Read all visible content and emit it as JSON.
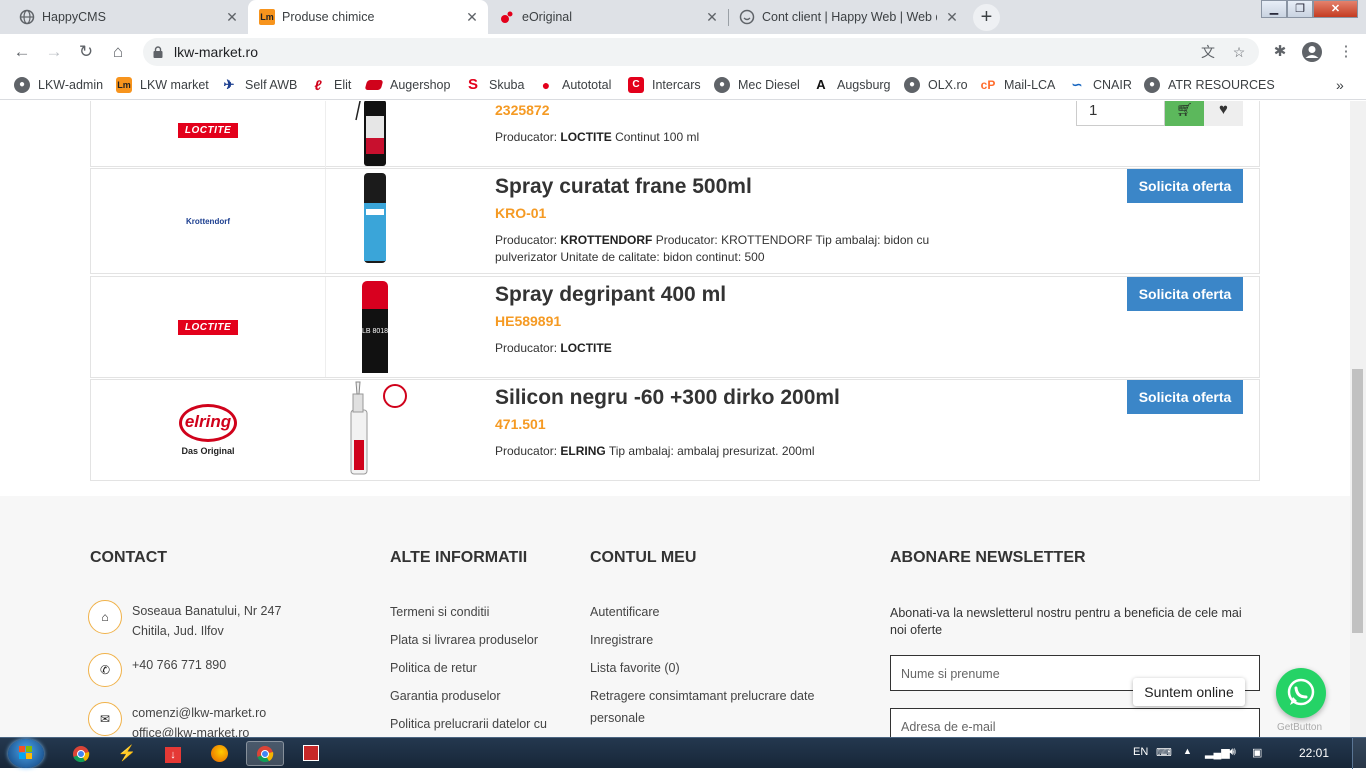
{
  "browser": {
    "tabs": [
      {
        "title": "HappyCMS",
        "active": false,
        "icon": "globe-icon"
      },
      {
        "title": "Produse chimice",
        "active": true,
        "icon": "lm-icon"
      },
      {
        "title": "eOriginal",
        "active": false,
        "icon": "eoriginal-icon"
      },
      {
        "title": "Cont client | Happy Web | Web d",
        "active": false,
        "icon": "happyweb-icon"
      }
    ],
    "url": "lkw-market.ro",
    "bookmarks": [
      {
        "label": "LKW-admin",
        "icon": "globe-icon"
      },
      {
        "label": "LKW market",
        "icon": "lm-icon"
      },
      {
        "label": "Self AWB",
        "icon": "awb-icon"
      },
      {
        "label": "Elit",
        "icon": "elit-icon"
      },
      {
        "label": "Augershop",
        "icon": "augershop-icon"
      },
      {
        "label": "Skuba",
        "icon": "skuba-icon"
      },
      {
        "label": "Autototal",
        "icon": "autototal-icon"
      },
      {
        "label": "Intercars",
        "icon": "intercars-icon"
      },
      {
        "label": "Mec Diesel",
        "icon": "globe-icon"
      },
      {
        "label": "Augsburg",
        "icon": "augsburg-icon"
      },
      {
        "label": "OLX.ro",
        "icon": "globe-icon"
      },
      {
        "label": "Mail-LCA",
        "icon": "cpanel-icon"
      },
      {
        "label": "CNAIR",
        "icon": "cnair-icon"
      },
      {
        "label": "ATR RESOURCES",
        "icon": "globe-icon"
      }
    ]
  },
  "products": [
    {
      "brand": "LOCTITE",
      "name": "",
      "code": "2325872",
      "producer_label": "Producator:",
      "producer": "LOCTITE",
      "details": "Continut 100 ml",
      "qty": "1"
    },
    {
      "brand": "Krottendorf",
      "name": "Spray curatat frane 500ml",
      "code": "KRO-01",
      "producer_label": "Producator:",
      "producer": "KROTTENDORF",
      "details": "Producator: KROTTENDORF Tip ambalaj: bidon cu pulverizator Unitate de calitate: bidon continut: 500",
      "action": "Solicita oferta"
    },
    {
      "brand": "LOCTITE",
      "name": "Spray degripant 400 ml",
      "code": "HE589891",
      "producer_label": "Producator:",
      "producer": "LOCTITE",
      "details": "",
      "action": "Solicita oferta"
    },
    {
      "brand": "elring",
      "brand_sub": "Das Original",
      "name": "Silicon negru -60 +300 dirko 200ml",
      "code": "471.501",
      "producer_label": "Producator:",
      "producer": "ELRING",
      "details": "Tip ambalaj: ambalaj presurizat. 200ml",
      "action": "Solicita oferta"
    }
  ],
  "footer": {
    "contact": {
      "heading": "CONTACT",
      "address_line1": "Soseaua Banatului, Nr 247",
      "address_line2": "Chitila, Jud. Ilfov",
      "phone": "+40 766 771 890",
      "email1": "comenzi@lkw-market.ro",
      "email2": "office@lkw-market.ro"
    },
    "alte": {
      "heading": "ALTE INFORMATII",
      "links": [
        "Termeni si conditii",
        "Plata si livrarea produselor",
        "Politica de retur",
        "Garantia produselor",
        "Politica prelucrarii datelor cu"
      ]
    },
    "cont": {
      "heading": "CONTUL MEU",
      "links": [
        "Autentificare",
        "Inregistrare",
        "Lista favorite (0)",
        "Retragere consimtamant prelucrare date",
        "personale"
      ]
    },
    "newsletter": {
      "heading": "ABONARE NEWSLETTER",
      "text": "Abonati-va la newsletterul nostru pentru a beneficia de cele mai noi oferte",
      "name_placeholder": "Nume si prenume",
      "email_placeholder": "Adresa de e-mail"
    }
  },
  "whatsapp": {
    "label": "Suntem online",
    "credit": "GetButton"
  },
  "taskbar": {
    "lang": "EN",
    "time": "22:01"
  },
  "colors": {
    "accent_orange": "#f59a23",
    "offer_blue": "#3b86c8",
    "cart_green": "#5cb85c",
    "whatsapp": "#25d366"
  }
}
